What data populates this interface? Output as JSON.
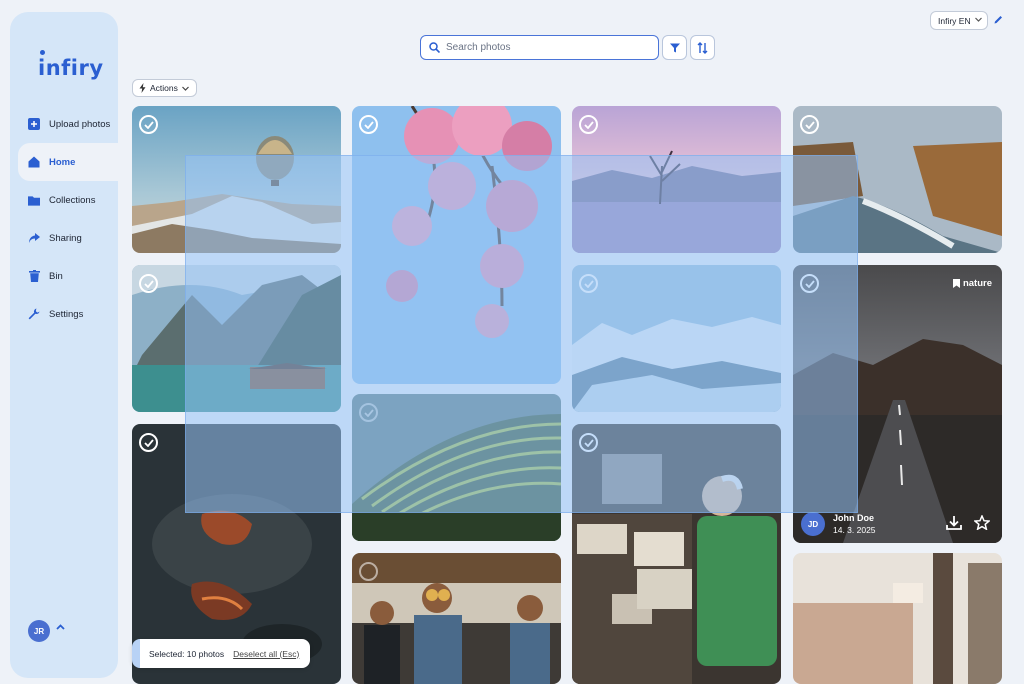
{
  "app": {
    "name": "infiry"
  },
  "sidebar": {
    "items": [
      {
        "label": "Upload photos",
        "icon": "plus-square-icon"
      },
      {
        "label": "Home",
        "icon": "home-icon",
        "active": true
      },
      {
        "label": "Collections",
        "icon": "folder-icon"
      },
      {
        "label": "Sharing",
        "icon": "share-arrow-icon"
      },
      {
        "label": "Bin",
        "icon": "trash-icon"
      },
      {
        "label": "Settings",
        "icon": "wrench-icon"
      }
    ],
    "user_initials": "JR"
  },
  "topbar": {
    "search_placeholder": "Search photos",
    "language": "Infiry EN"
  },
  "toolbar": {
    "actions_label": "Actions"
  },
  "featured_photo": {
    "tag": "nature",
    "author_initials": "JD",
    "author": "John Doe",
    "date": "14. 3. 2025"
  },
  "selection": {
    "status": "Selected: 10 photos",
    "deselect_label": "Deselect all (Esc)"
  },
  "colors": {
    "accent": "#2b5fd1",
    "sidebar": "#d5e6f8",
    "background": "#eef2f8"
  }
}
